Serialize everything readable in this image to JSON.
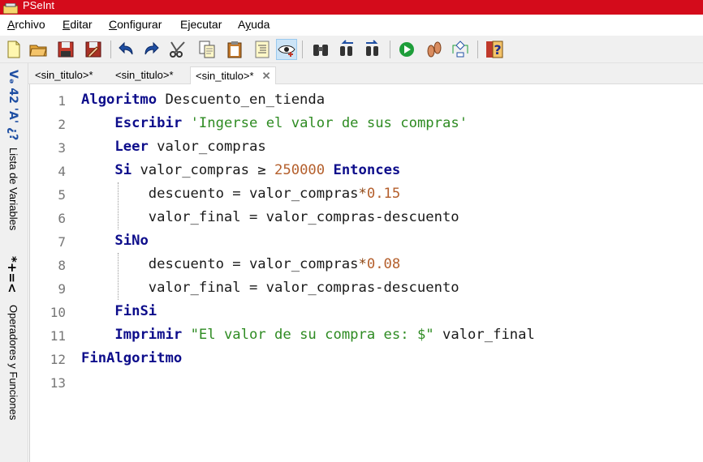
{
  "window": {
    "title": "PSeInt"
  },
  "menu": {
    "items": [
      {
        "label": "Archivo",
        "accel": "A",
        "rest": "rchivo"
      },
      {
        "label": "Editar",
        "accel": "E",
        "rest": "ditar"
      },
      {
        "label": "Configurar",
        "accel": "C",
        "rest": "onfigurar"
      },
      {
        "label": "Ejecutar",
        "accel": "j",
        "pre": "E",
        "rest": "ecutar"
      },
      {
        "label": "Ayuda",
        "accel": "y",
        "pre": "A",
        "rest": "uda"
      }
    ]
  },
  "toolbar": {
    "buttons": [
      {
        "icon": "new-file-icon"
      },
      {
        "icon": "open-folder-icon"
      },
      {
        "icon": "save-icon"
      },
      {
        "icon": "save-as-icon"
      },
      {
        "icon": "undo-icon"
      },
      {
        "icon": "redo-icon"
      },
      {
        "icon": "cut-icon"
      },
      {
        "icon": "copy-icon"
      },
      {
        "icon": "paste-icon"
      },
      {
        "icon": "indent-icon"
      },
      {
        "icon": "inspect-variables-icon"
      },
      {
        "icon": "find-icon"
      },
      {
        "icon": "find-previous-icon"
      },
      {
        "icon": "find-next-icon"
      },
      {
        "icon": "run-icon"
      },
      {
        "icon": "step-by-step-icon"
      },
      {
        "icon": "flowchart-icon"
      },
      {
        "icon": "help-icon"
      }
    ]
  },
  "side_panel": {
    "symbols_top": "Vₔ 42 'A' ¿?",
    "variables_label": "Lista de Variables",
    "operators_symbols": "*+=<",
    "operators_label": "Operadores y Funciones"
  },
  "tabs": [
    {
      "label": "<sin_titulo>*"
    },
    {
      "label": "<sin_titulo>*"
    },
    {
      "label": "<sin_titulo>*",
      "close": "✕"
    }
  ],
  "editor": {
    "line_numbers": [
      "1",
      "2",
      "3",
      "4",
      "5",
      "6",
      "7",
      "8",
      "9",
      "10",
      "11",
      "12",
      "13"
    ],
    "lines": [
      [
        {
          "t": "Algoritmo",
          "c": "kw"
        },
        {
          "t": " Descuento_en_tienda",
          "c": ""
        }
      ],
      [
        {
          "t": "    ",
          "c": ""
        },
        {
          "t": "Escribir",
          "c": "kw"
        },
        {
          "t": " ",
          "c": ""
        },
        {
          "t": "'Ingerse el valor de sus compras'",
          "c": "str"
        }
      ],
      [
        {
          "t": "    ",
          "c": ""
        },
        {
          "t": "Leer",
          "c": "kw"
        },
        {
          "t": " valor_compras",
          "c": ""
        }
      ],
      [
        {
          "t": "    ",
          "c": ""
        },
        {
          "t": "Si",
          "c": "kw"
        },
        {
          "t": " valor_compras ≥ ",
          "c": ""
        },
        {
          "t": "250000",
          "c": "num"
        },
        {
          "t": " ",
          "c": ""
        },
        {
          "t": "Entonces",
          "c": "kw"
        }
      ],
      [
        {
          "t": "        descuento = valor_compras",
          "c": ""
        },
        {
          "t": "*",
          "c": "op"
        },
        {
          "t": "0.15",
          "c": "num"
        }
      ],
      [
        {
          "t": "        valor_final = valor_compras-descuento",
          "c": ""
        }
      ],
      [
        {
          "t": "    ",
          "c": ""
        },
        {
          "t": "SiNo",
          "c": "kw"
        }
      ],
      [
        {
          "t": "        descuento = valor_compras",
          "c": ""
        },
        {
          "t": "*",
          "c": "op"
        },
        {
          "t": "0.08",
          "c": "num"
        }
      ],
      [
        {
          "t": "        valor_final = valor_compras-descuento",
          "c": ""
        }
      ],
      [
        {
          "t": "    ",
          "c": ""
        },
        {
          "t": "FinSi",
          "c": "kw"
        }
      ],
      [
        {
          "t": "    ",
          "c": ""
        },
        {
          "t": "Imprimir",
          "c": "kw"
        },
        {
          "t": " ",
          "c": ""
        },
        {
          "t": "\"El valor de su compra es: $\"",
          "c": "str"
        },
        {
          "t": " valor_final",
          "c": ""
        }
      ],
      [
        {
          "t": "FinAlgoritmo",
          "c": "kw"
        }
      ],
      []
    ]
  },
  "colors": {
    "titlebar": "#d40b1b",
    "keyword": "#0d0d8b",
    "string": "#2e8b22",
    "number": "#b45f2c"
  }
}
